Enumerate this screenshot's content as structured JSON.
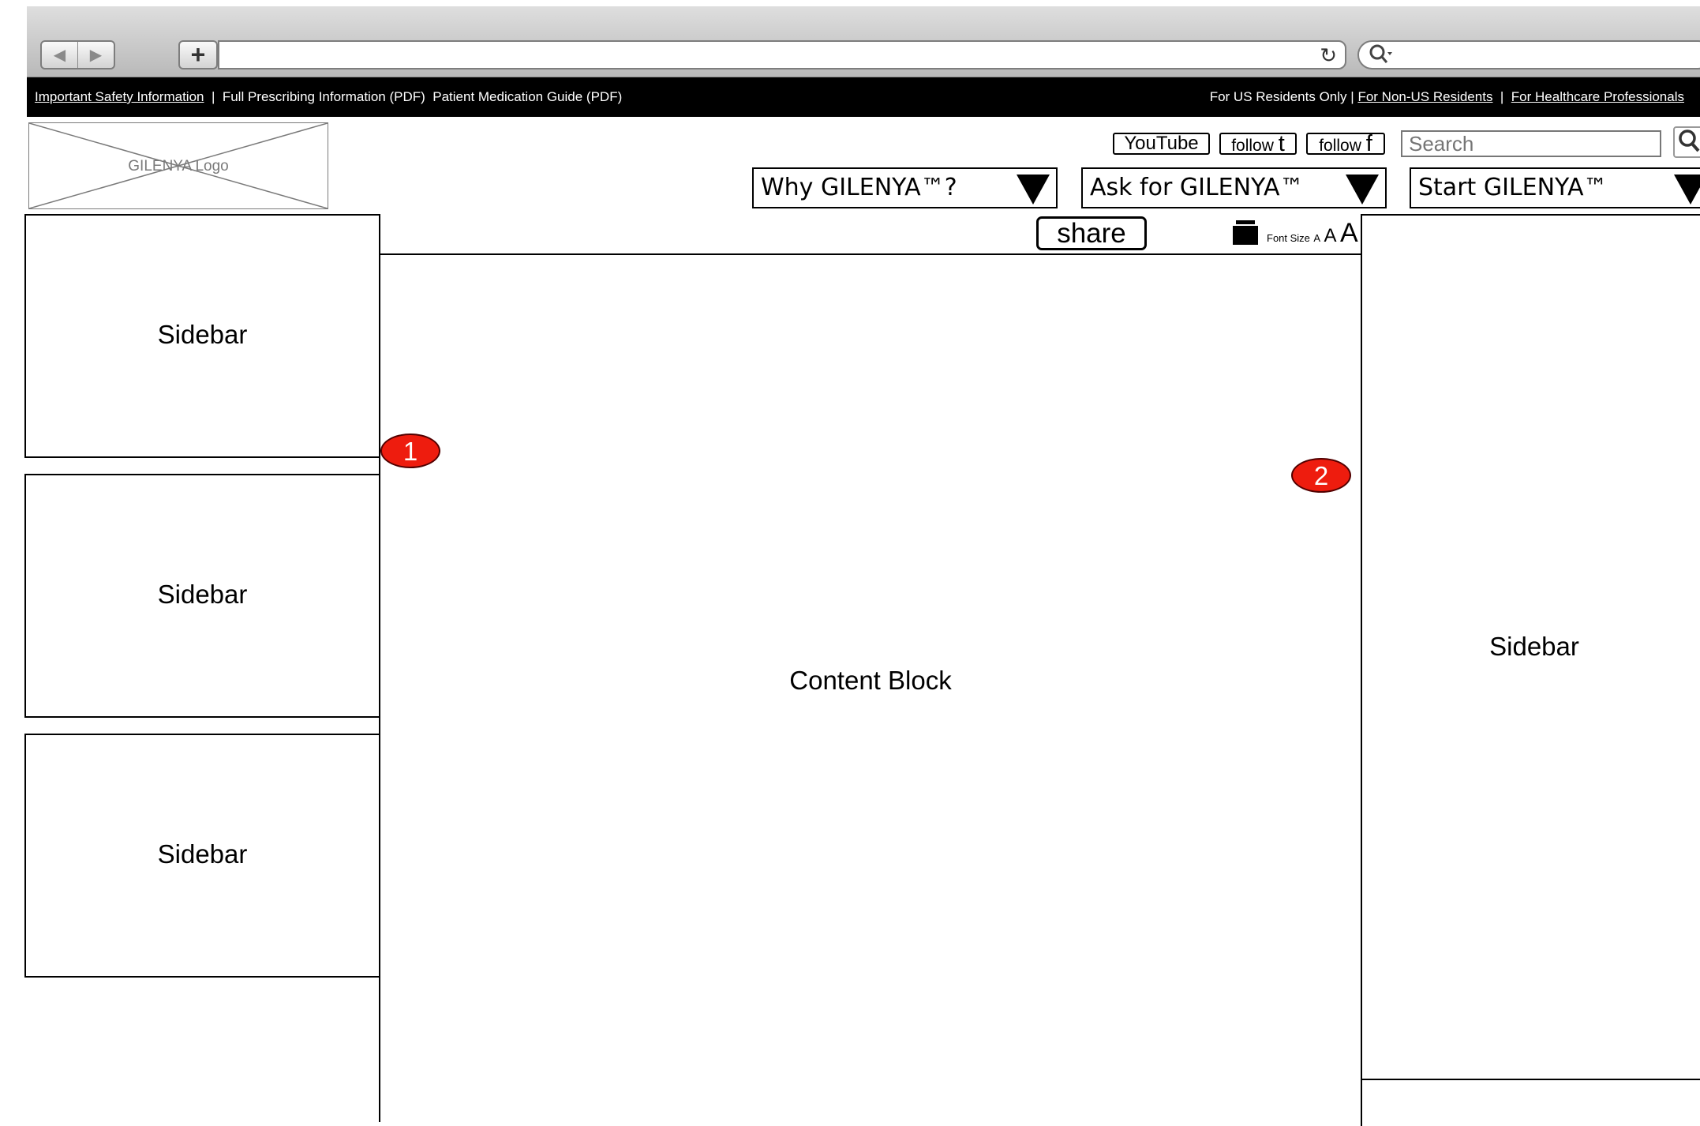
{
  "browser": {
    "back_icon": "◀",
    "forward_icon": "▶",
    "new_tab_icon": "+",
    "reload_icon": "↻",
    "search_icon": "🔍"
  },
  "utility_bar": {
    "safety_info": "Important Safety Information",
    "separator": "|",
    "prescribing_info": "Full Prescribing Information (PDF)",
    "medication_guide": "Patient Medication Guide (PDF)",
    "us_residents": "For US Residents Only",
    "non_us_residents": "For Non-US Residents",
    "healthcare_professionals": "For Healthcare Professionals"
  },
  "logo": {
    "label": "GILENYA Logo"
  },
  "social": {
    "youtube": "YouTube",
    "follow_text": "follow",
    "twitter_glyph": "t",
    "facebook_glyph": "f"
  },
  "search": {
    "placeholder": "Search"
  },
  "nav": {
    "why": "Why GILENYA™?",
    "ask": "Ask for GILENYA™",
    "start": "Start GILENYA™"
  },
  "tools": {
    "share": "share",
    "font_size_label": "Font Size",
    "font_small": "A",
    "font_medium": "A",
    "font_large": "A"
  },
  "layout_labels": {
    "sidebar": "Sidebar",
    "content_block": "Content Block"
  },
  "markers": {
    "first": "1",
    "second": "2"
  },
  "colors": {
    "marker": "#ee1c0e",
    "utility_bar": "#000000"
  }
}
